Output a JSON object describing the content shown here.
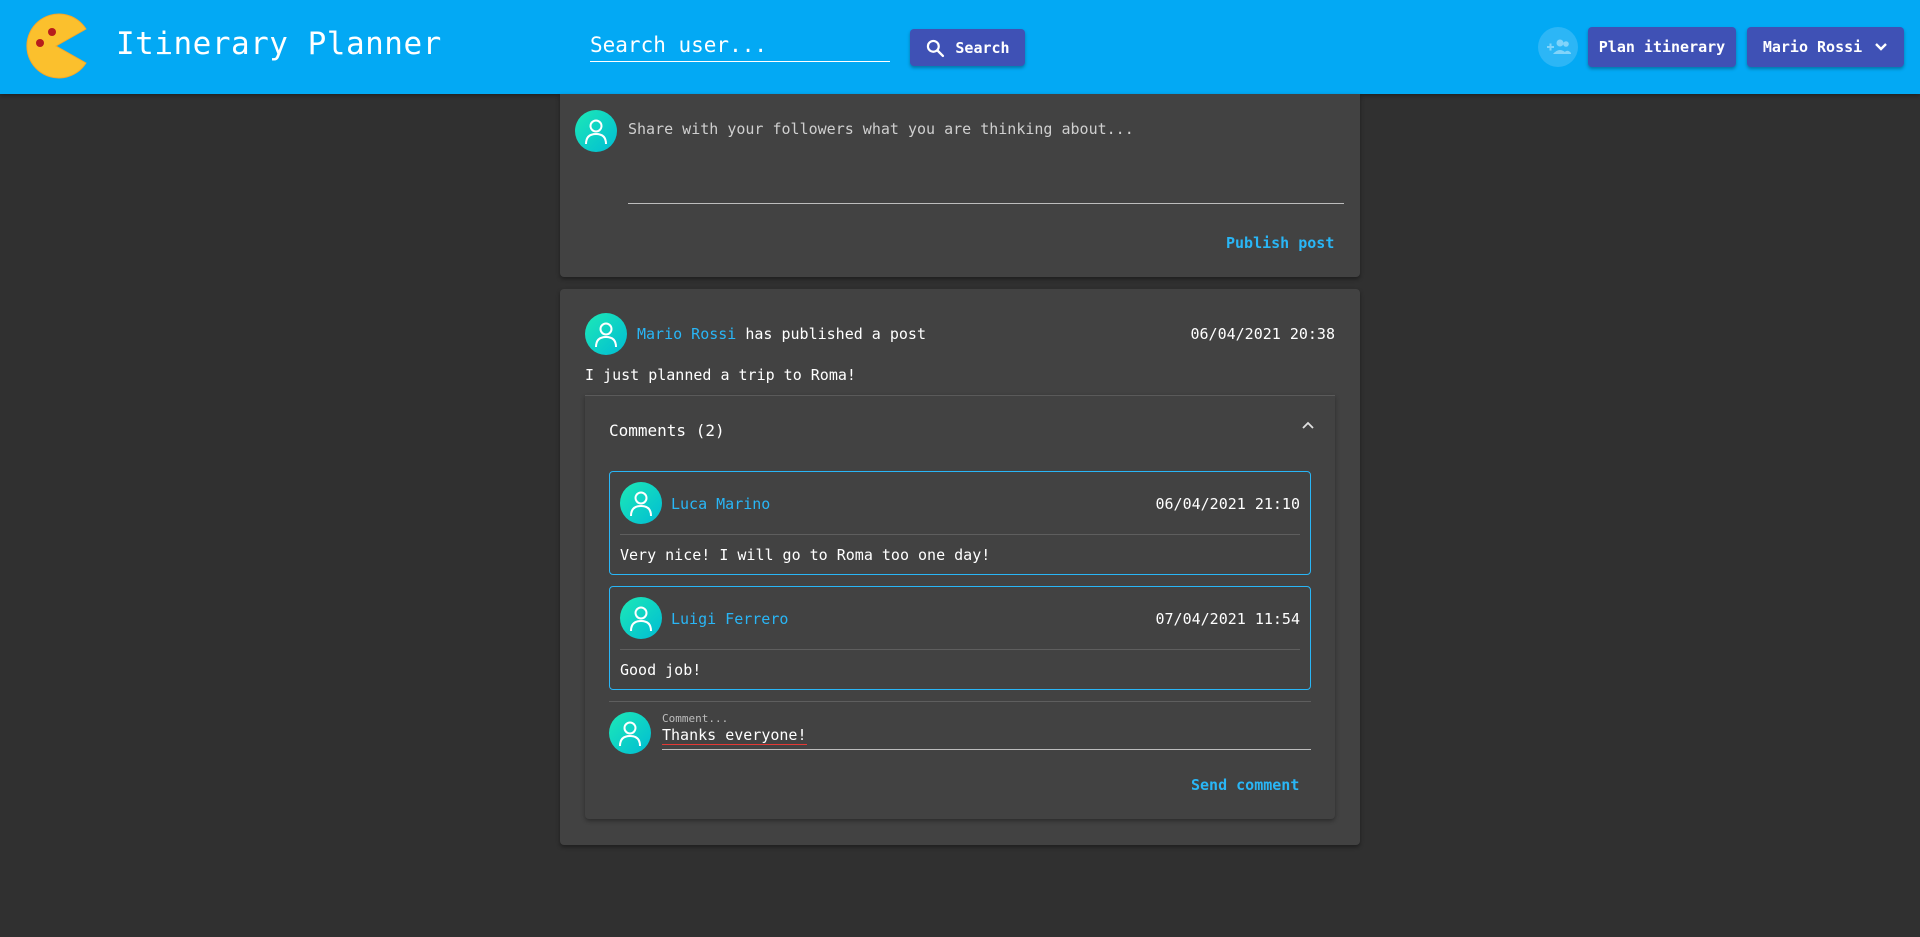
{
  "header": {
    "title": "Itinerary Planner",
    "search_placeholder": "Search user...",
    "search_label": "Search",
    "plan_label": "Plan itinerary",
    "user_menu_label": "Mario Rossi"
  },
  "composer": {
    "placeholder": "Share with your followers what you are thinking about...",
    "publish_label": "Publish post"
  },
  "post": {
    "author": "Mario Rossi",
    "action": "has published a post",
    "date": "06/04/2021 20:38",
    "text": "I just planned a trip to Roma!",
    "comments_title": "Comments (2)",
    "comments": [
      {
        "author": "Luca Marino",
        "date": "06/04/2021 21:10",
        "text": "Very nice! I will go to Roma too one day!"
      },
      {
        "author": "Luigi Ferrero",
        "date": "07/04/2021 11:54",
        "text": "Good job!"
      }
    ],
    "new_comment": {
      "label": "Comment...",
      "value": "Thanks everyone!",
      "send_label": "Send comment"
    }
  },
  "colors": {
    "header": "#03a9f4",
    "button": "#3f51b5",
    "link": "#29b6f6",
    "background": "#303030",
    "card": "#424242"
  },
  "icons": [
    "pacman-logo-icon",
    "search-icon",
    "group-add-icon",
    "chevron-down-icon",
    "user-avatar-icon",
    "chevron-up-icon"
  ]
}
